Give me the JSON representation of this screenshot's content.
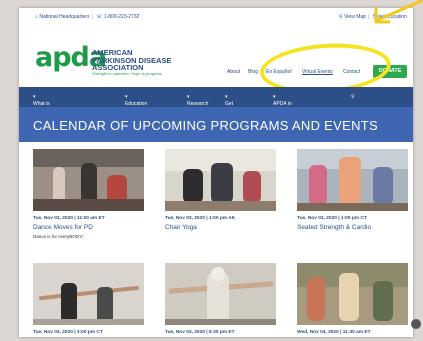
{
  "topbar": {
    "hq": "National Headquarters",
    "phone": "1-800-223-2732",
    "map": "View Map",
    "locations": "Select Location"
  },
  "logo": {
    "mark": "apda",
    "line1": "AMERICAN",
    "line2": "PARKINSON DISEASE",
    "line3": "ASSOCIATION",
    "tagline": "Strength to optimism. Hope to progress."
  },
  "nav": {
    "about": "About",
    "blog": "Blog",
    "espanol": "En Español",
    "virtual": "Virtual Events",
    "contact": "Contact",
    "donate": "DONATE"
  },
  "menu": {
    "item1": "What is Parkinson's Disease?",
    "item2": "Education & Support",
    "item3": "Research",
    "item4": "Get Involved",
    "item5": "APDA in Your Community"
  },
  "banner": {
    "title": "CALENDAR OF UPCOMING PROGRAMS AND EVENTS"
  },
  "events": [
    {
      "date": "Tue, Nov 03, 2020 | 11:00 am ET",
      "title": "Dance Moves for PD",
      "desc": "Dance is for everyBODY!"
    },
    {
      "date": "Tue, Nov 03, 2020 | 1:00 pm AK",
      "title": "Chair Yoga",
      "desc": ""
    },
    {
      "date": "Tue, Nov 03, 2020 | 1:00 pm CT",
      "title": "Seated Strength & Cardio",
      "desc": ""
    },
    {
      "date": "Tue, Nov 03, 2020 | 3:00 pm CT",
      "title": "",
      "desc": ""
    },
    {
      "date": "Tue, Nov 03, 2020 | 5:30 pm ET",
      "title": "",
      "desc": ""
    },
    {
      "date": "Wed, Nov 04, 2020 | 11:30 am ET",
      "title": "",
      "desc": ""
    }
  ],
  "colors": {
    "brand_blue": "#2b4f86",
    "brand_green": "#1f9a48",
    "banner": "#3e66b3",
    "highlight": "#f7e21f"
  }
}
